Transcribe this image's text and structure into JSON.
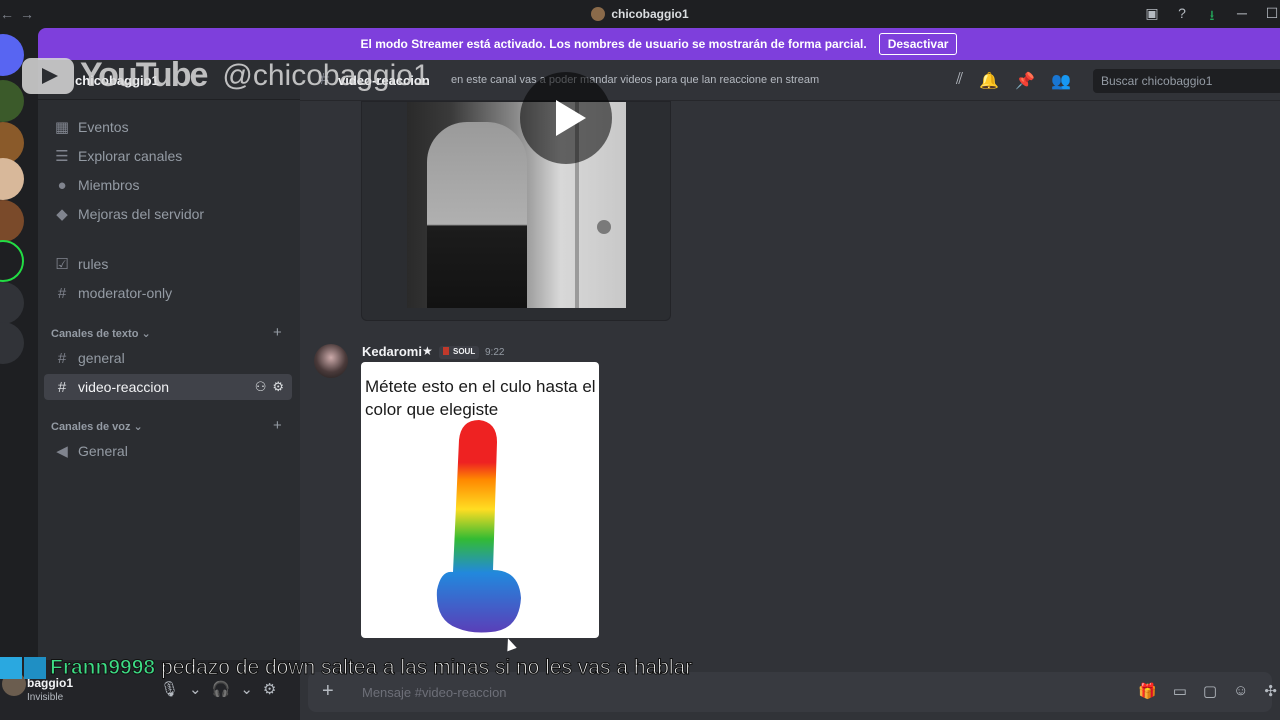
{
  "window": {
    "title": "chicobaggio1"
  },
  "banner": {
    "text": "El modo Streamer está activado. Los nombres de usuario se mostrarán de forma parcial.",
    "button": "Desactivar"
  },
  "watermark": {
    "brand": "YouTube",
    "handle": "@chicobaggio1"
  },
  "guild": {
    "name": "chicobaggio1"
  },
  "sidebar": {
    "items": [
      {
        "label": "Eventos",
        "icon": "calendar-icon"
      },
      {
        "label": "Explorar canales",
        "icon": "browse-icon"
      },
      {
        "label": "Miembros",
        "icon": "members-icon"
      },
      {
        "label": "Mejoras del servidor",
        "icon": "boost-icon"
      },
      {
        "label": "rules",
        "icon": "rules-icon"
      },
      {
        "label": "moderator-only",
        "icon": "hash-icon"
      }
    ],
    "text_category": "Canales de texto",
    "text_channels": [
      "general",
      "video-reaccion"
    ],
    "voice_category": "Canales de voz",
    "voice_channels": [
      "General"
    ]
  },
  "user": {
    "name": "baggio1",
    "status": "Invisible"
  },
  "channel": {
    "name": "video-reaccion",
    "topic": "en este canal vas a poder mandar videos para que lan reaccione en stream",
    "search_placeholder": "Buscar chicobaggio1"
  },
  "message": {
    "author": "Kedaromi",
    "star": "★",
    "tag": "SOUL",
    "time": "9:22",
    "image_caption": "Métete esto en el culo hasta el color que elegiste"
  },
  "composer": {
    "placeholder": "Mensaje #video-reaccion"
  },
  "overlay": {
    "user": "Frann9998",
    "message": "pedazo de down saltea a las minas si no les vas a hablar"
  },
  "colors": {
    "banner": "#7e3fdc",
    "overlay_user": "#3ddc84"
  }
}
